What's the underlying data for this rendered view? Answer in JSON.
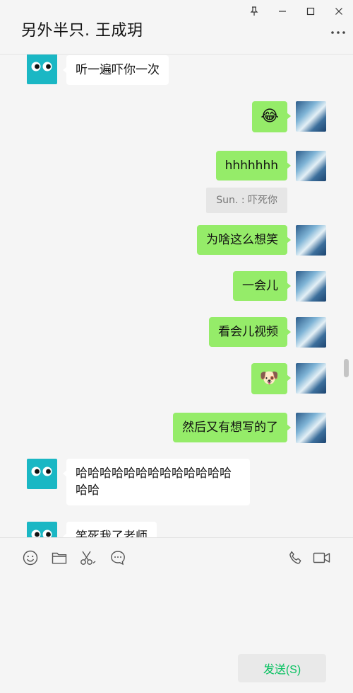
{
  "window": {
    "title": "另外半只. 王成玥"
  },
  "messages": [
    {
      "from": "other",
      "text": "听一遍吓你一次"
    },
    {
      "from": "self",
      "text": "😂"
    },
    {
      "from": "self",
      "text": "hhhhhhh"
    },
    {
      "quote": "Sun. : 吓死你"
    },
    {
      "from": "self",
      "text": "为啥这么想笑"
    },
    {
      "from": "self",
      "text": "一会儿"
    },
    {
      "from": "self",
      "text": "看会儿视频"
    },
    {
      "from": "self",
      "text": "🐶"
    },
    {
      "from": "self",
      "text": "然后又有想写的了"
    },
    {
      "from": "other",
      "text": "哈哈哈哈哈哈哈哈哈哈哈哈哈哈哈"
    },
    {
      "from": "other",
      "text": "笑死我了老师"
    }
  ],
  "toolbar": {
    "icons": [
      "emoji-icon",
      "folder-icon",
      "scissors-icon",
      "chat-bubble-icon",
      "phone-icon",
      "video-icon"
    ]
  },
  "composer": {
    "send_label": "发送(S)"
  },
  "colors": {
    "self_bubble": "#95ec69",
    "other_bubble": "#ffffff",
    "other_avatar": "#1ab7c4",
    "send_text": "#07c160"
  }
}
